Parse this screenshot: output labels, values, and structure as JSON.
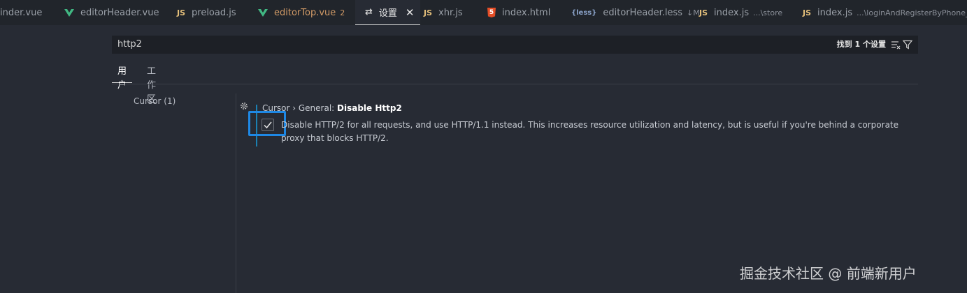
{
  "tabs": [
    {
      "label": "inder.vue",
      "icon": "vue-icon",
      "suffix": ""
    },
    {
      "label": "editorHeader.vue",
      "icon": "vue-icon",
      "suffix": ""
    },
    {
      "label": "preload.js",
      "icon": "js-icon",
      "icon_text": "JS",
      "suffix": ""
    },
    {
      "label": "editorTop.vue",
      "icon": "vue-icon",
      "suffix": "2"
    },
    {
      "label": "设置",
      "icon": "settings-icon",
      "suffix": ""
    },
    {
      "label": "xhr.js",
      "icon": "js-icon",
      "icon_text": "JS",
      "suffix": ""
    },
    {
      "label": "index.html",
      "icon": "html-icon",
      "icon_text": "5",
      "suffix": ""
    },
    {
      "label": "editorHeader.less",
      "icon": "less-icon",
      "icon_text": "{less}",
      "suffix": "↓M"
    },
    {
      "label": "index.js",
      "icon": "js-icon",
      "icon_text": "JS",
      "suffix": "...\\store"
    },
    {
      "label": "index.js",
      "icon": "js-icon",
      "icon_text": "JS",
      "suffix": "...\\loginAndRegisterByPhone_zh"
    }
  ],
  "search": {
    "value": "http2",
    "result_count": "找到 1 个设置"
  },
  "scope_tabs": [
    "用户",
    "工作区"
  ],
  "toc": {
    "item": "Cursor (1)"
  },
  "setting": {
    "category": "Cursor › General: ",
    "name": "Disable Http2",
    "checked": true,
    "description": "Disable HTTP/2 for all requests, and use HTTP/1.1 instead. This increases resource utilization and latency, but is useful if you're behind a corporate proxy that blocks HTTP/2."
  },
  "watermark": "掘金技术社区 @ 前端新用户",
  "colors": {
    "accent": "#1e88e5",
    "modified_bar": "#1b80b2",
    "vue": "#41b883",
    "js": "#e5c07b",
    "html": "#e44d26"
  }
}
